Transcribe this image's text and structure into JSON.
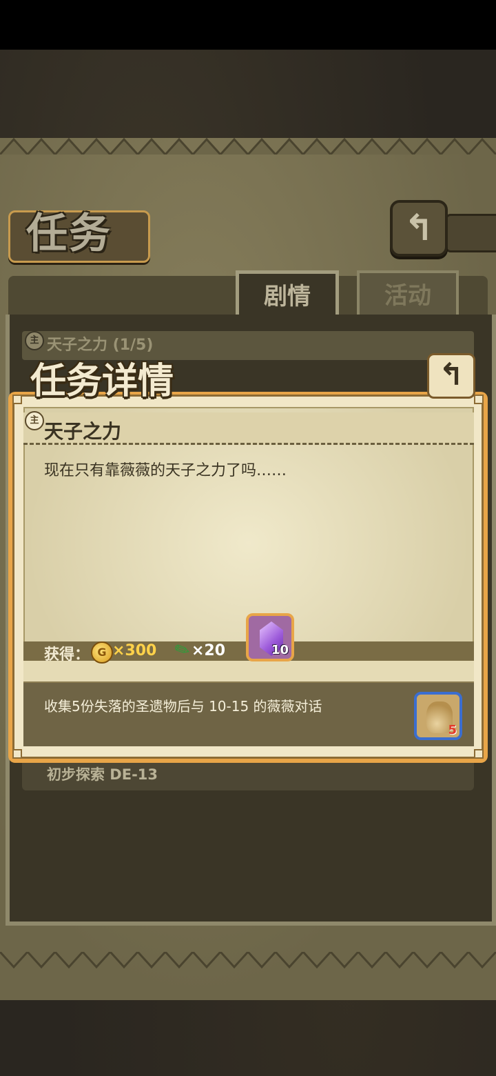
{
  "header": {
    "title": "任务",
    "back_icon": "return-arrow-icon"
  },
  "tabs": [
    {
      "label": "剧情",
      "active": true
    },
    {
      "label": "活动",
      "active": false
    }
  ],
  "list": {
    "item_1": "天子之力 (1/5)",
    "item_2": "初步探索 DE-13"
  },
  "modal": {
    "title": "任务详情",
    "mission_name": "天子之力",
    "description": "现在只有靠薇薇的天子之力了吗……",
    "rewards": {
      "label": "获得：",
      "coin_symbol": "G",
      "coin_amount": "×300",
      "feather_amount": "×20",
      "gem_count": "10"
    },
    "task": "收集5份失落的圣遗物后与 10-15 的薇薇对话",
    "relic_count": "5",
    "badge_glyph": "主"
  },
  "colors": {
    "accent": "#e8a548",
    "parchment": "#d9cfa8",
    "gold_text": "#ffd24a",
    "relic_border": "#3b6ed0"
  }
}
